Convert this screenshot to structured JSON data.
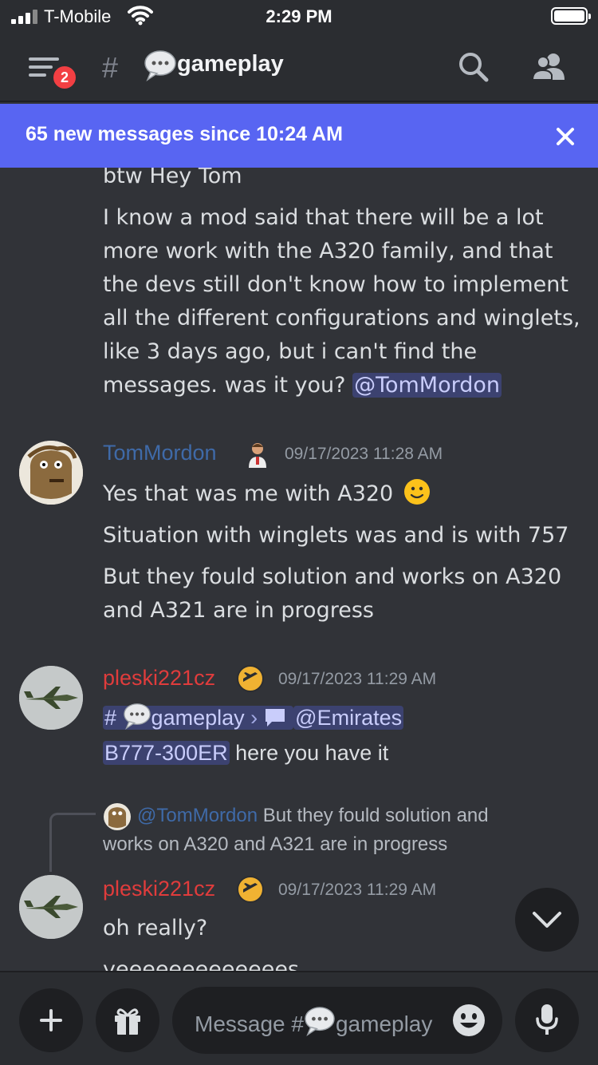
{
  "status": {
    "carrier": "T-Mobile",
    "time": "2:29 PM"
  },
  "header": {
    "badge": "2",
    "hash": "#",
    "channel_emoji": "speech-balloon-emoji",
    "channel": "gameplay"
  },
  "new_messages": {
    "text": "65 new messages since 10:24 AM"
  },
  "messages": {
    "cont": {
      "line1": "btw Hey Tom",
      "line2": "I know a mod said that there will be a lot",
      "line3": "more work with the A320 family, and that",
      "line4": "the devs still don't know how to implement",
      "line5": "all the different configurations and winglets,",
      "line6": "like 3 days ago, but i can't find the",
      "line7": "messages. was it you?",
      "mention": "@TomMordon"
    },
    "m1": {
      "author": "TomMordon",
      "timestamp": "09/17/2023 11:28 AM",
      "author_color": "#3f6aa8",
      "line1": "Yes that was me with A320",
      "line2": "Situation with winglets was and is with 757",
      "line3": "But they fould solution and works on A320",
      "line4": "and A321 are in progress"
    },
    "m2": {
      "author": "pleski221cz",
      "timestamp": "09/17/2023 11:29 AM",
      "author_color": "#e03c3c",
      "link_hash": "#",
      "link_channel": "gameplay",
      "link_sep": "›",
      "thread_mention": "@Emirates",
      "thread_mention2": "B777-300ER",
      "text_after": " here you have it"
    },
    "reply": {
      "mention": "@TomMordon",
      "text1": " But they fould solution and",
      "text2": "works on A320 and A321 are in progress"
    },
    "m3": {
      "author": "pleski221cz",
      "timestamp": "09/17/2023 11:29 AM",
      "line1": "oh really?",
      "line2": "yeeeeeeeeeeeees"
    }
  },
  "composer": {
    "placeholder_prefix": "Message #",
    "placeholder_channel": "gameplay"
  },
  "colors": {
    "accent": "#5865f2",
    "background": "#313338",
    "mention_bg": "#3c4270"
  }
}
